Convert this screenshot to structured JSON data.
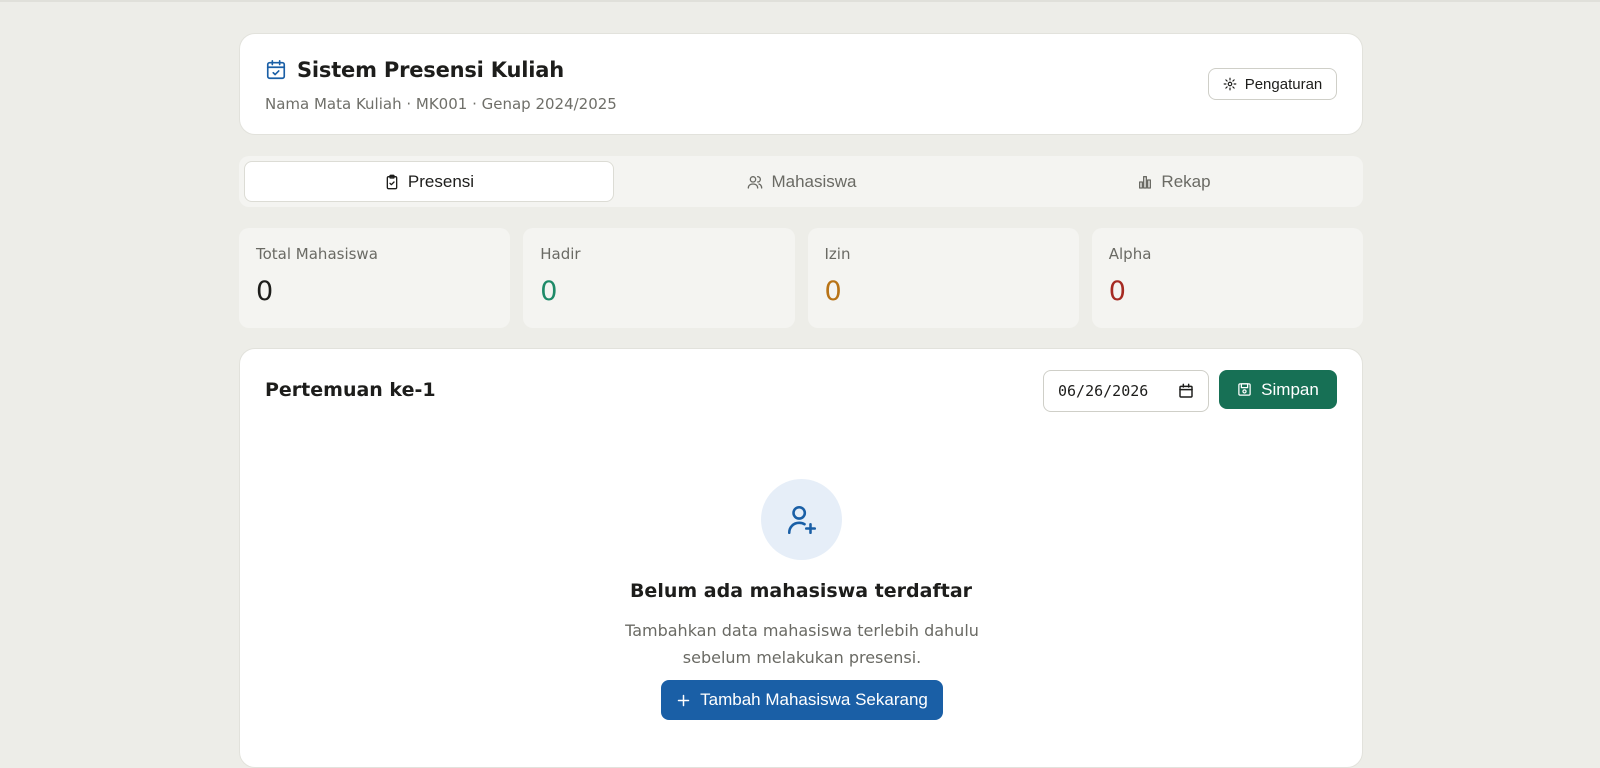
{
  "header": {
    "title": "Sistem Presensi Kuliah",
    "subtitle": "Nama Mata Kuliah · MK001 · Genap 2024/2025",
    "settings_label": "Pengaturan",
    "title_icon": "calendar-check-icon",
    "settings_icon": "gear-icon"
  },
  "tabs": [
    {
      "label": "Presensi",
      "icon": "clipboard-check-icon",
      "active": true
    },
    {
      "label": "Mahasiswa",
      "icon": "users-icon",
      "active": false
    },
    {
      "label": "Rekap",
      "icon": "bar-chart-icon",
      "active": false
    }
  ],
  "stats": [
    {
      "label": "Total Mahasiswa",
      "value": "0",
      "color": "#1d1d1b"
    },
    {
      "label": "Hadir",
      "value": "0",
      "color": "#1e8a68"
    },
    {
      "label": "Izin",
      "value": "0",
      "color": "#b87316"
    },
    {
      "label": "Alpha",
      "value": "0",
      "color": "#a52a22"
    }
  ],
  "meeting": {
    "title": "Pertemuan ke-1",
    "date": "06/26/2026",
    "save_label": "Simpan"
  },
  "empty_state": {
    "icon": "user-plus-icon",
    "title": "Belum ada mahasiswa terdaftar",
    "description_line1": "Tambahkan data mahasiswa terlebih dahulu",
    "description_line2": "sebelum melakukan presensi.",
    "add_label": "Tambah Mahasiswa Sekarang"
  },
  "colors": {
    "primary_green": "#177055",
    "primary_blue": "#1a5fa6",
    "background": "#edede8"
  }
}
